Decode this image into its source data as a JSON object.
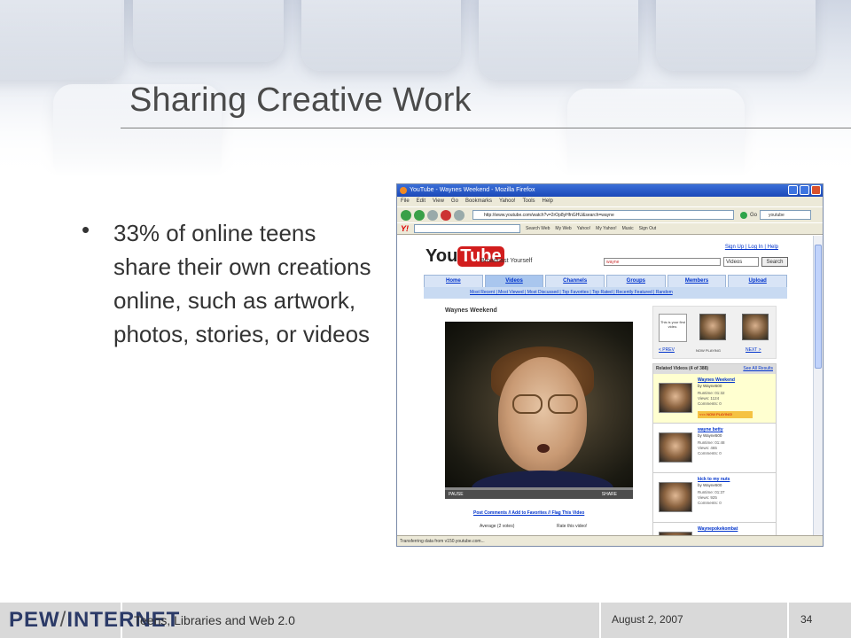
{
  "slide": {
    "title": "Sharing Creative Work",
    "bullet_marker": "•",
    "bullet": "33% of online teens share their own creations online, such as artwork, photos, stories, or videos"
  },
  "browser": {
    "window_title": "YouTube - Waynes Weekend - Mozilla Firefox",
    "menu": [
      "File",
      "Edit",
      "View",
      "Go",
      "Bookmarks",
      "Yahoo!",
      "Tools",
      "Help"
    ],
    "url": "http://www.youtube.com/watch?v=2rOp8yHfnGHU&search=wayne",
    "go_label": "Go",
    "search_value": "youtube",
    "yahoo_logo": "Y!",
    "yahoo_items": [
      "Search Web",
      "My Web",
      "Yahoo!",
      "My Yahoo!",
      "Music",
      "Sign Out"
    ],
    "status": "Transferring data from v150.youtube.com..."
  },
  "youtube": {
    "logo_you": "You",
    "logo_tube": "Tube",
    "tagline": "Broadcast Yourself",
    "top_links": "Sign Up | Log In | Help",
    "search_value": "wayne",
    "search_scope": "Videos",
    "search_button": "Search",
    "tabs": [
      "Home",
      "Videos",
      "Channels",
      "Groups",
      "Members",
      "Upload"
    ],
    "subnav": "Most Recent | Most Viewed | Most Discussed | Top Favorites | Top Rated | Recently Featured | Random",
    "video_title": "Waynes Weekend",
    "controls_left": "PAUSE",
    "controls_mid": "SHARE",
    "video_links": "Post Comments  //  Add to Favorites  //  Flag This Video",
    "rating_avg": "Average (2 votes)",
    "rating_this": "Rate this video!",
    "queue_first": "This is your first video.",
    "queue_prev": "< PREV",
    "queue_now": "NOW PLAYING",
    "queue_next": "NEXT >",
    "related_head": "Related Videos (4 of 388)",
    "related_see_all": "See All Results",
    "related": [
      {
        "title": "Waynes Weekend",
        "by": "by Wayne500",
        "runtime": "Runtime: 01:32",
        "views": "Views: 1124",
        "comments": "Comments: 0",
        "now": "<<< NOW PLAYING!"
      },
      {
        "title": "wayne betty",
        "by": "by Wayne500",
        "runtime": "Runtime: 01:48",
        "views": "Views: 465",
        "comments": "Comments: 0"
      },
      {
        "title": "kick to my nuts",
        "by": "by Wayne500",
        "runtime": "Runtime: 01:37",
        "views": "Views: 925",
        "comments": "Comments: 0"
      },
      {
        "title": "Waynepokekombat"
      }
    ]
  },
  "footer": {
    "logo_left": "PEW",
    "logo_slash": "/",
    "logo_right": "INTERNET",
    "title": "Teens, Libraries and Web 2.0",
    "date": "August 2, 2007",
    "page": "34"
  }
}
